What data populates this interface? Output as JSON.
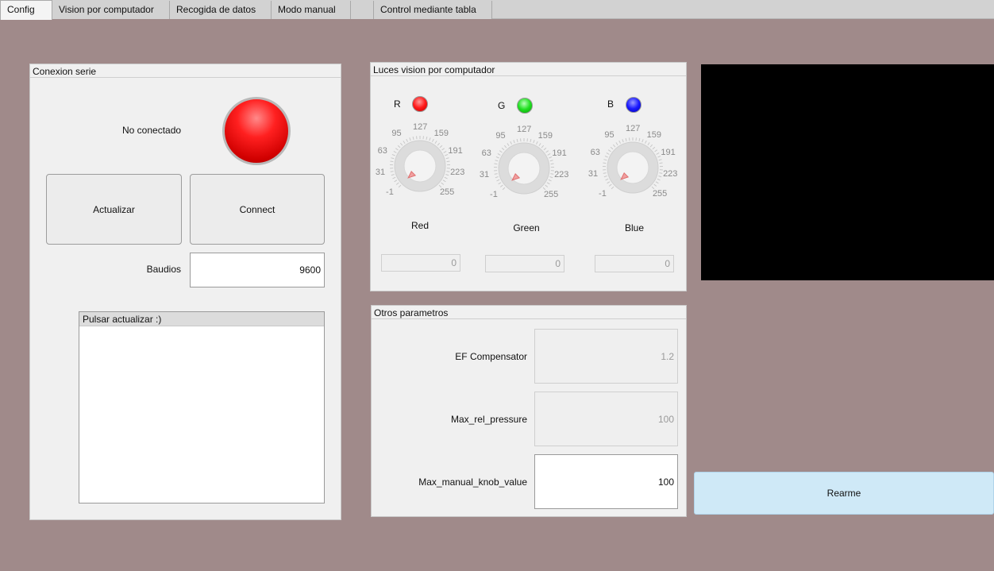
{
  "tabs": [
    {
      "label": "Config"
    },
    {
      "label": "Vision por computador"
    },
    {
      "label": "Recogida de datos"
    },
    {
      "label": "Modo manual"
    },
    {
      "label": ""
    },
    {
      "label": "Control mediante tabla"
    }
  ],
  "serial": {
    "title": "Conexion serie",
    "status": "No conectado",
    "status_color": "#ff2020",
    "refresh_label": "Actualizar",
    "connect_label": "Connect",
    "baud_label": "Baudios",
    "baud_value": "9600",
    "list_header": "Pulsar actualizar :)"
  },
  "lights": {
    "title": "Luces vision por computador",
    "channels": [
      {
        "letter": "R",
        "name": "Red",
        "value": "0",
        "color": "#ff1a1a"
      },
      {
        "letter": "G",
        "name": "Green",
        "value": "0",
        "color": "#20e020"
      },
      {
        "letter": "B",
        "name": "Blue",
        "value": "0",
        "color": "#1a1aff"
      }
    ],
    "ticks": [
      "-1",
      "31",
      "63",
      "95",
      "127",
      "159",
      "191",
      "223",
      "255"
    ]
  },
  "params": {
    "title": "Otros parametros",
    "ef_label": "EF Compensator",
    "ef_value": "1.2",
    "maxrel_label": "Max_rel_pressure",
    "maxrel_value": "100",
    "maxknob_label": "Max_manual_knob_value",
    "maxknob_value": "100"
  },
  "rearme_label": "Rearme"
}
